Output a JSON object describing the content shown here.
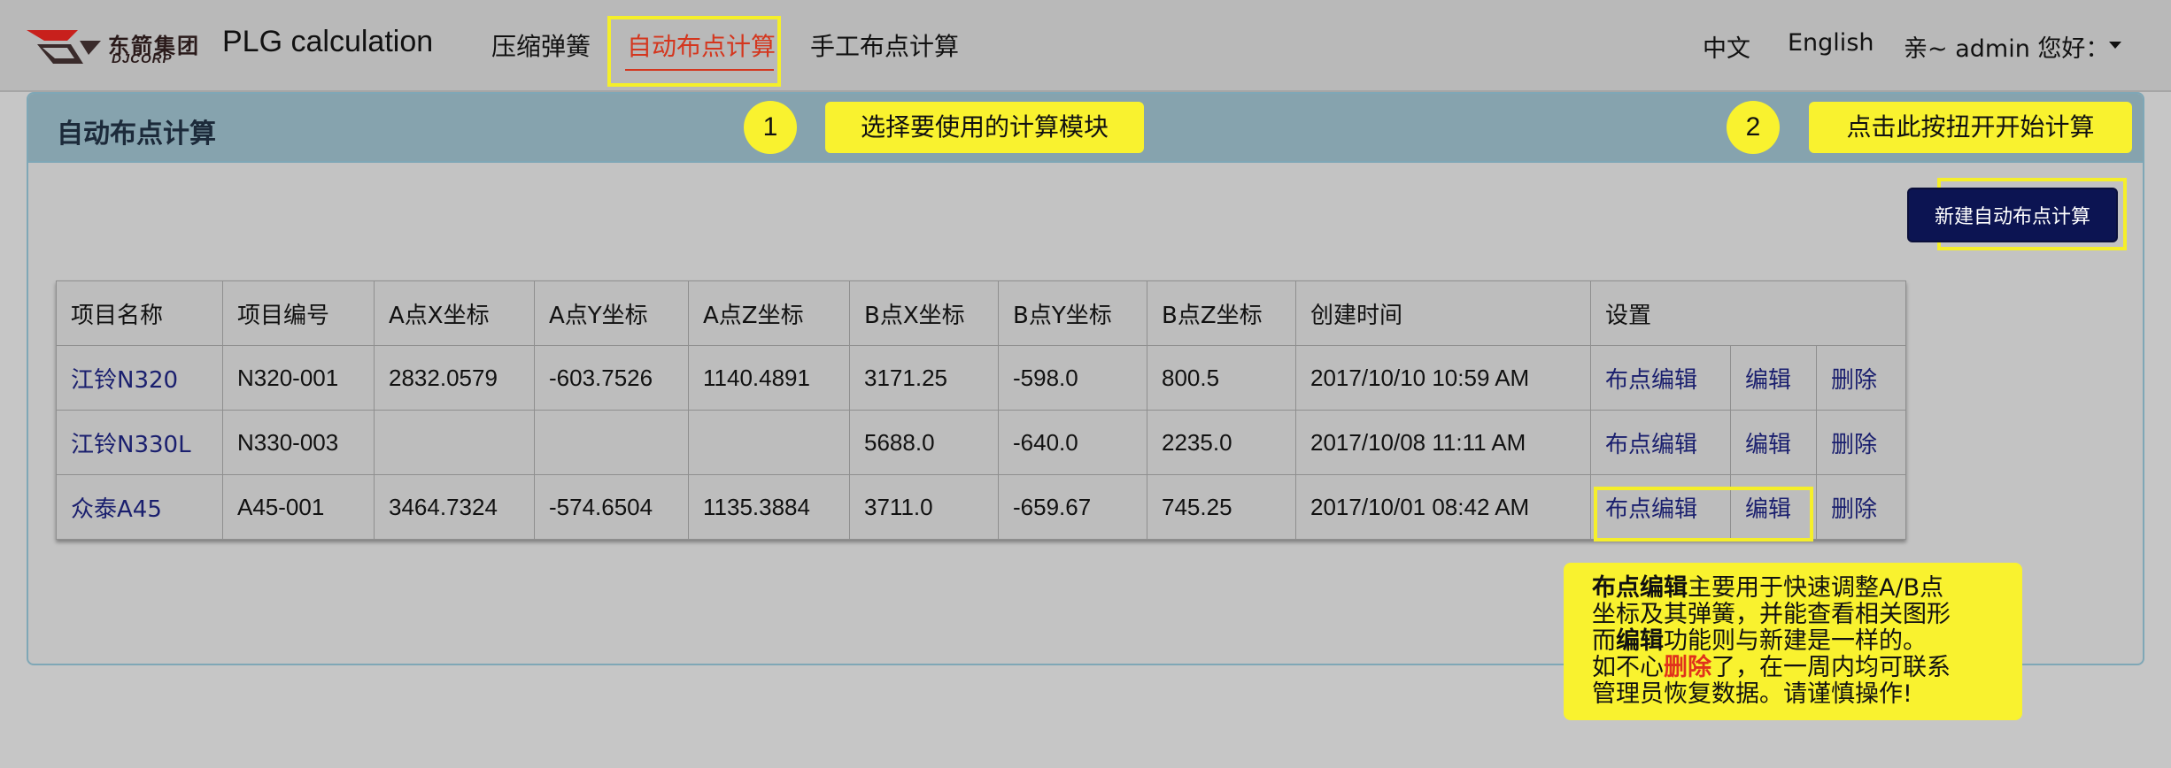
{
  "topbar": {
    "logo": {
      "cn": "东箭集团",
      "en": "DJCORP"
    },
    "app_title": "PLG calculation",
    "nav": [
      {
        "label": "压缩弹簧",
        "active": false
      },
      {
        "label": "自动布点计算",
        "active": true
      },
      {
        "label": "手工布点计算",
        "active": false
      }
    ],
    "lang_cn": "中文",
    "lang_en": "English",
    "greeting": "亲~ admin 您好："
  },
  "panel": {
    "title": "自动布点计算",
    "step1": {
      "num": "1",
      "label": "选择要使用的计算模块"
    },
    "step2": {
      "num": "2",
      "label": "点击此按扭开开始计算"
    },
    "new_button": "新建自动布点计算"
  },
  "table": {
    "headers": [
      "项目名称",
      "项目编号",
      "A点X坐标",
      "A点Y坐标",
      "A点Z坐标",
      "B点X坐标",
      "B点Y坐标",
      "B点Z坐标",
      "创建时间",
      "设置"
    ],
    "rows": [
      {
        "name": "江铃N320",
        "code": "N320-001",
        "ax": "2832.0579",
        "ay": "-603.7526",
        "az": "1140.4891",
        "bx": "3171.25",
        "by": "-598.0",
        "bz": "800.5",
        "created": "2017/10/10 10:59 AM",
        "edit_points": "布点编辑",
        "edit": "编辑",
        "delete": "删除"
      },
      {
        "name": "江铃N330L",
        "code": "N330-003",
        "ax": "",
        "ay": "",
        "az": "",
        "bx": "5688.0",
        "by": "-640.0",
        "bz": "2235.0",
        "created": "2017/10/08 11:11 AM",
        "edit_points": "布点编辑",
        "edit": "编辑",
        "delete": "删除"
      },
      {
        "name": "众泰A45",
        "code": "A45-001",
        "ax": "3464.7324",
        "ay": "-574.6504",
        "az": "1135.3884",
        "bx": "3711.0",
        "by": "-659.67",
        "bz": "745.25",
        "created": "2017/10/01 08:42 AM",
        "edit_points": "布点编辑",
        "edit": "编辑",
        "delete": "删除"
      }
    ]
  },
  "note": {
    "l1_bold": "布点编辑",
    "l1_rest": "主要用于快速调整A/B点",
    "l2": "坐标及其弹簧，并能查看相关图形",
    "l3_pre": "而",
    "l3_bold": "编辑",
    "l3_rest": "功能则与新建是一样的。",
    "l4_pre": "如不心",
    "l4_red": "删除",
    "l4_rest": "了，在一周内均可联系",
    "l5": "管理员恢复数据。请谨慎操作!"
  },
  "colors": {
    "accent_nav": "#d4361e",
    "highlight": "#f9f22f",
    "button_bg": "#0c1452",
    "link": "#1a1f6e"
  }
}
